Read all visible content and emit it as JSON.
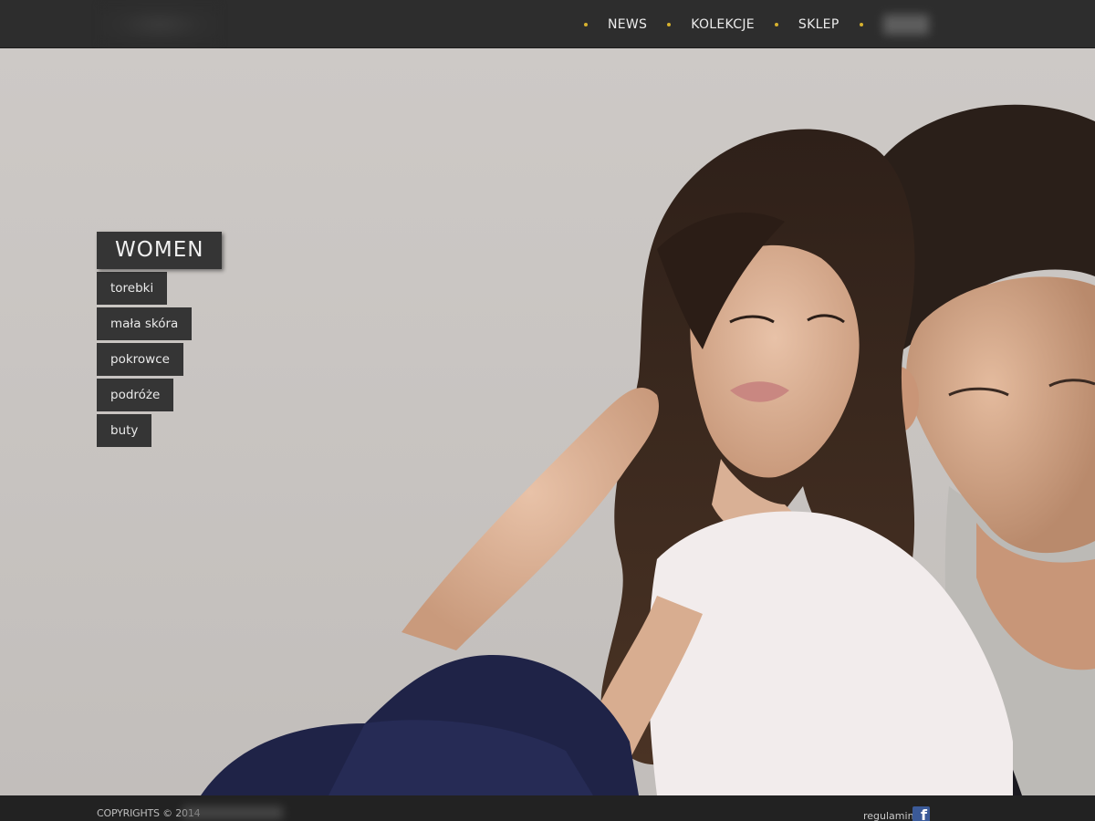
{
  "nav": {
    "items": [
      {
        "label": "NEWS"
      },
      {
        "label": "KOLEKCJE"
      },
      {
        "label": "SKLEP"
      }
    ]
  },
  "menu": {
    "title": "WOMEN",
    "items": [
      {
        "label": "torebki"
      },
      {
        "label": "mała skóra"
      },
      {
        "label": "pokrowce"
      },
      {
        "label": "podróże"
      },
      {
        "label": "buty"
      }
    ]
  },
  "footer": {
    "copyright": "COPYRIGHTS © 2014",
    "link": "regulamin",
    "facebook_icon": "f"
  },
  "colors": {
    "accent_dot": "#d6b12e",
    "bar_dark": "#2d2d2d",
    "menu_box": "#353535"
  }
}
